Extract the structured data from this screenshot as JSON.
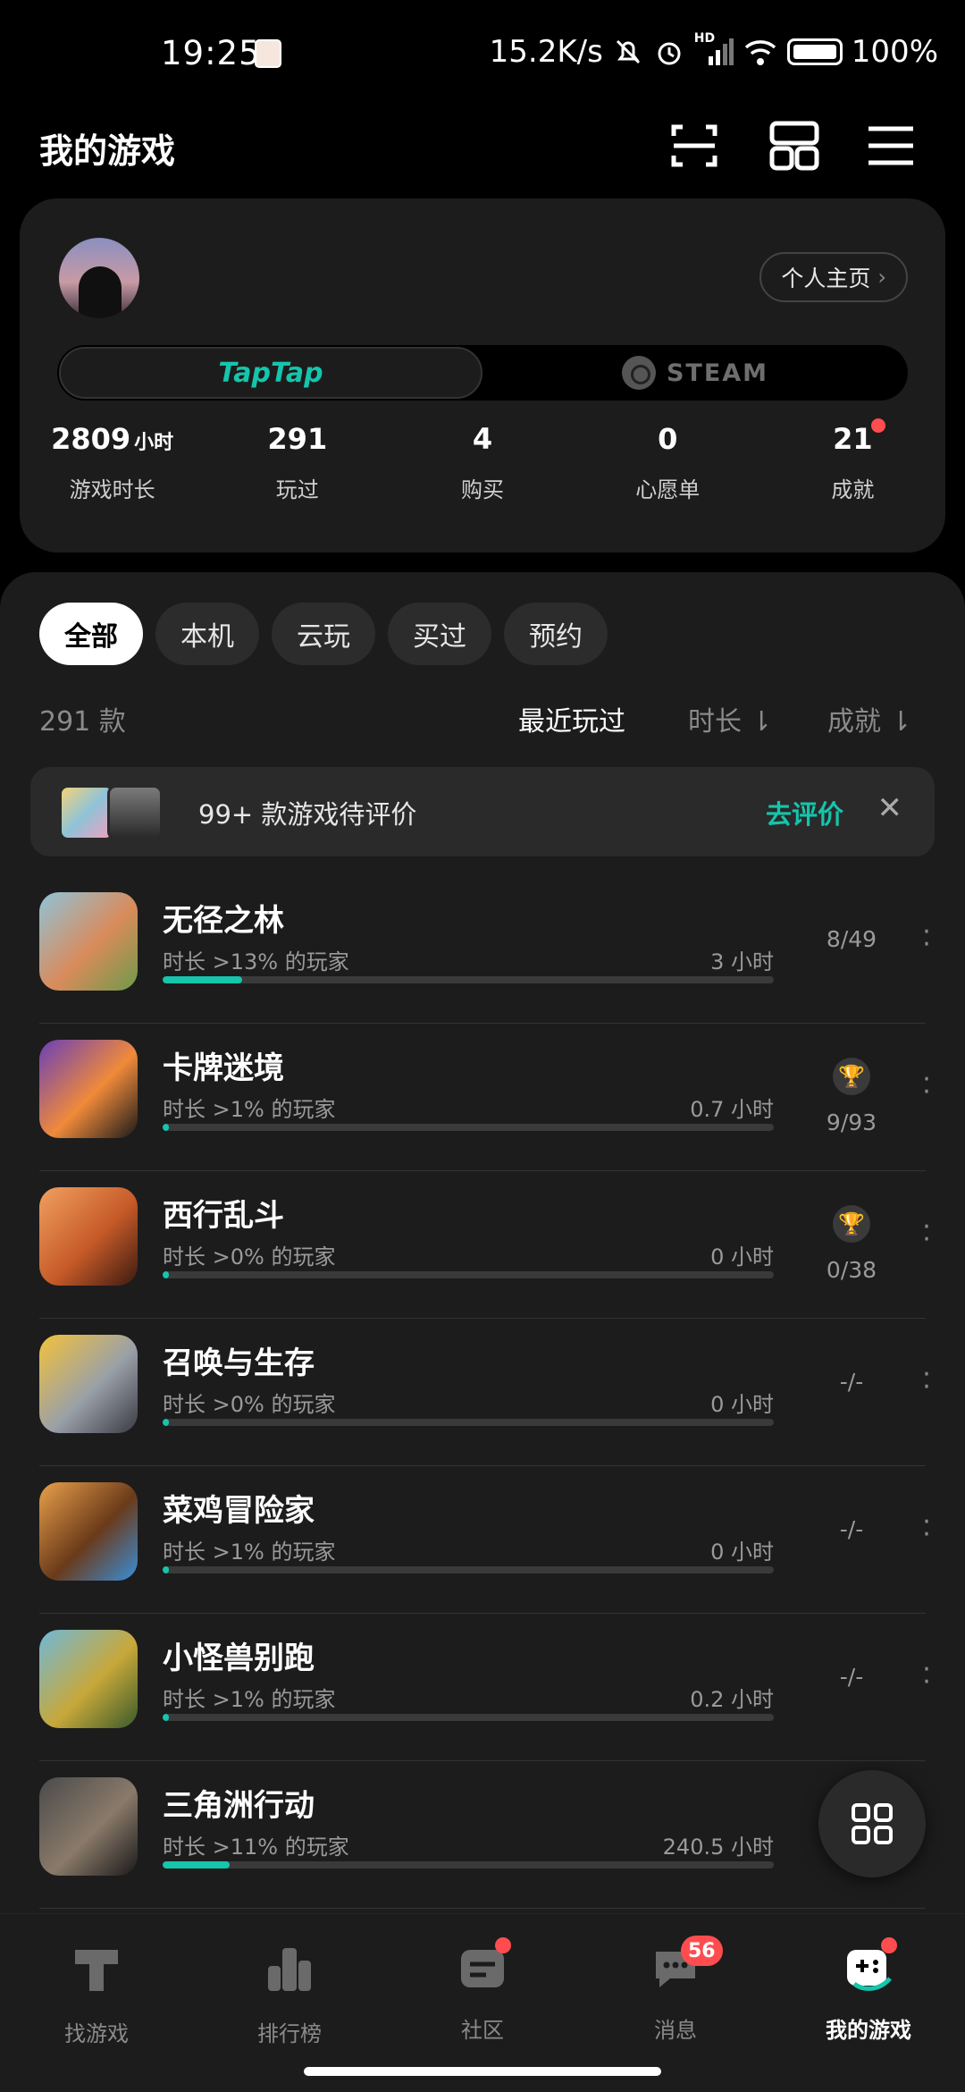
{
  "status_bar": {
    "time": "19:25",
    "network_speed": "15.2K/s",
    "network_type": "HD",
    "battery": "100%"
  },
  "header": {
    "title": "我的游戏",
    "icons": [
      "scan-icon",
      "grid-icon",
      "menu-icon"
    ]
  },
  "profile": {
    "homepage_label": "个人主页",
    "platforms": {
      "taptap": "TapTap",
      "steam": "STEAM"
    },
    "stats": [
      {
        "value": "2809",
        "unit": "小时",
        "label": "游戏时长"
      },
      {
        "value": "291",
        "unit": "",
        "label": "玩过"
      },
      {
        "value": "4",
        "unit": "",
        "label": "购买"
      },
      {
        "value": "0",
        "unit": "",
        "label": "心愿单"
      },
      {
        "value": "21",
        "unit": "",
        "label": "成就",
        "has_dot": true
      }
    ]
  },
  "filters": [
    "全部",
    "本机",
    "云玩",
    "买过",
    "预约"
  ],
  "active_filter": "全部",
  "list": {
    "count": "291 款",
    "sort_options": [
      "最近玩过",
      "时长 ⇂",
      "成就 ⇂"
    ],
    "active_sort": "最近玩过"
  },
  "review_banner": {
    "text": "99+ 款游戏待评价",
    "action": "去评价"
  },
  "games": [
    {
      "name": "无径之林",
      "subtitle": "时长 >13% 的玩家",
      "hours": "3 小时",
      "progress": 0.13,
      "achievement": "8/49",
      "trophy": false,
      "icon_colors": [
        "#8fc3d8",
        "#d98b5b",
        "#6e9a4a"
      ]
    },
    {
      "name": "卡牌迷境",
      "subtitle": "时长 >1% 的玩家",
      "hours": "0.7 小时",
      "progress": 0.01,
      "achievement": "9/93",
      "trophy": true,
      "icon_colors": [
        "#6a3fb8",
        "#f08a3a",
        "#1a1a1a"
      ]
    },
    {
      "name": "西行乱斗",
      "subtitle": "时长 >0% 的玩家",
      "hours": "0 小时",
      "progress": 0.0,
      "achievement": "0/38",
      "trophy": true,
      "icon_colors": [
        "#f0a060",
        "#c65a28",
        "#3a1a10"
      ]
    },
    {
      "name": "召唤与生存",
      "subtitle": "时长 >0% 的玩家",
      "hours": "0 小时",
      "progress": 0.0,
      "achievement": "-/-",
      "trophy": false,
      "icon_colors": [
        "#f2c23a",
        "#9aa0a8",
        "#3a3a44"
      ]
    },
    {
      "name": "菜鸡冒险家",
      "subtitle": "时长 >1% 的玩家",
      "hours": "0 小时",
      "progress": 0.01,
      "achievement": "-/-",
      "trophy": false,
      "icon_colors": [
        "#e9a04a",
        "#6a3a1a",
        "#3a8fd8"
      ]
    },
    {
      "name": "小怪兽别跑",
      "subtitle": "时长 >1% 的玩家",
      "hours": "0.2 小时",
      "progress": 0.01,
      "achievement": "-/-",
      "trophy": false,
      "icon_colors": [
        "#6fb8d8",
        "#c8a83a",
        "#3a5a2a"
      ]
    },
    {
      "name": "三角洲行动",
      "subtitle": "时长 >11% 的玩家",
      "hours": "240.5 小时",
      "progress": 0.11,
      "achievement": "",
      "trophy": false,
      "icon_colors": [
        "#4a4a4a",
        "#8a7a6a",
        "#1a1a1a"
      ]
    }
  ],
  "bottom_nav": [
    {
      "label": "找游戏",
      "icon": "taptap-icon"
    },
    {
      "label": "排行榜",
      "icon": "ranking-icon"
    },
    {
      "label": "社区",
      "icon": "community-icon",
      "dot": true
    },
    {
      "label": "消息",
      "icon": "message-icon",
      "badge": "56"
    },
    {
      "label": "我的游戏",
      "icon": "my-games-icon",
      "dot": true,
      "active": true
    }
  ],
  "colors": {
    "accent": "#15c5ac",
    "background": "#000000",
    "card": "#1c1c1c",
    "badge": "#ff4d4f"
  }
}
